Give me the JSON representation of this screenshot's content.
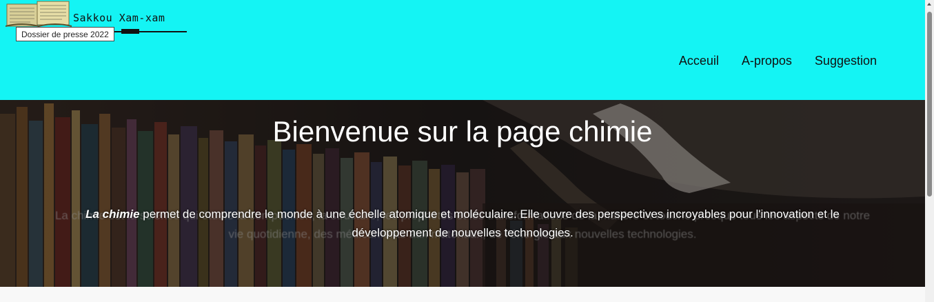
{
  "header": {
    "logo_text": "Sakkou Xam-xam",
    "tooltip": "Dossier de presse 2022",
    "nav": [
      {
        "label": "Acceuil"
      },
      {
        "label": "A-propos"
      },
      {
        "label": "Suggestion"
      }
    ],
    "bg_color": "#14f4f4"
  },
  "hero": {
    "title": "Bienvenue sur la page chimie",
    "text_emphasis": "La chimie",
    "text": " permet de comprendre le monde à une échelle atomique et moléculaire. Elle ouvre des perspectives incroyables pour l'innovation et le développement de nouvelles technologies.",
    "ghost_text": "La chimie est la science qui étudie la composition, la structure, les propriétés et les transformations de la matière et touche presque tous les aspects de notre vie quotidienne, des médicaments aux matériaux, de l'énergie aux nouvelles technologies."
  },
  "icons": {
    "logo": "books-icon",
    "scroll_up": "chevron-up-icon"
  }
}
